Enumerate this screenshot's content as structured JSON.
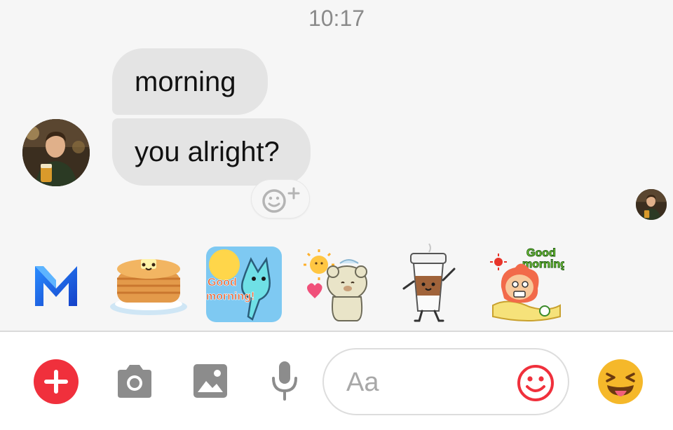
{
  "header": {
    "timestamp": "10:17"
  },
  "thread": {
    "messages": [
      {
        "text": "morning",
        "direction": "incoming"
      },
      {
        "text": "you alright?",
        "direction": "incoming"
      }
    ],
    "reaction_button": {
      "icon": "add-reaction-icon"
    },
    "read_receipt": {
      "icon": "contact-avatar"
    }
  },
  "sticker_suggestions": {
    "items": [
      {
        "name": "m-assistant",
        "icon": "messenger-m-logo"
      },
      {
        "name": "pancakes",
        "icon": "pancake-sticker"
      },
      {
        "name": "good-morning-cat",
        "icon": "cat-sticker",
        "text": "Good morning!"
      },
      {
        "name": "bear-sun",
        "icon": "bear-sticker"
      },
      {
        "name": "coffee-cup",
        "icon": "coffee-sticker"
      },
      {
        "name": "good-morning-lion",
        "icon": "lion-sticker",
        "text": "Good morning"
      }
    ]
  },
  "composer": {
    "placeholder": "Aa",
    "tools": [
      "plus-icon",
      "camera-icon",
      "gallery-icon",
      "microphone-icon"
    ],
    "emoji_icon": "smiley-icon",
    "quick_reaction_icon": "tongue-wink-emoji"
  },
  "colors": {
    "background": "#f6f6f6",
    "bubble": "#e4e4e4",
    "plus_button": "#f0303c",
    "emoji_button": "#f0303c",
    "tool_gray": "#8c8c8c",
    "quick_reaction": "#f5b82a"
  }
}
